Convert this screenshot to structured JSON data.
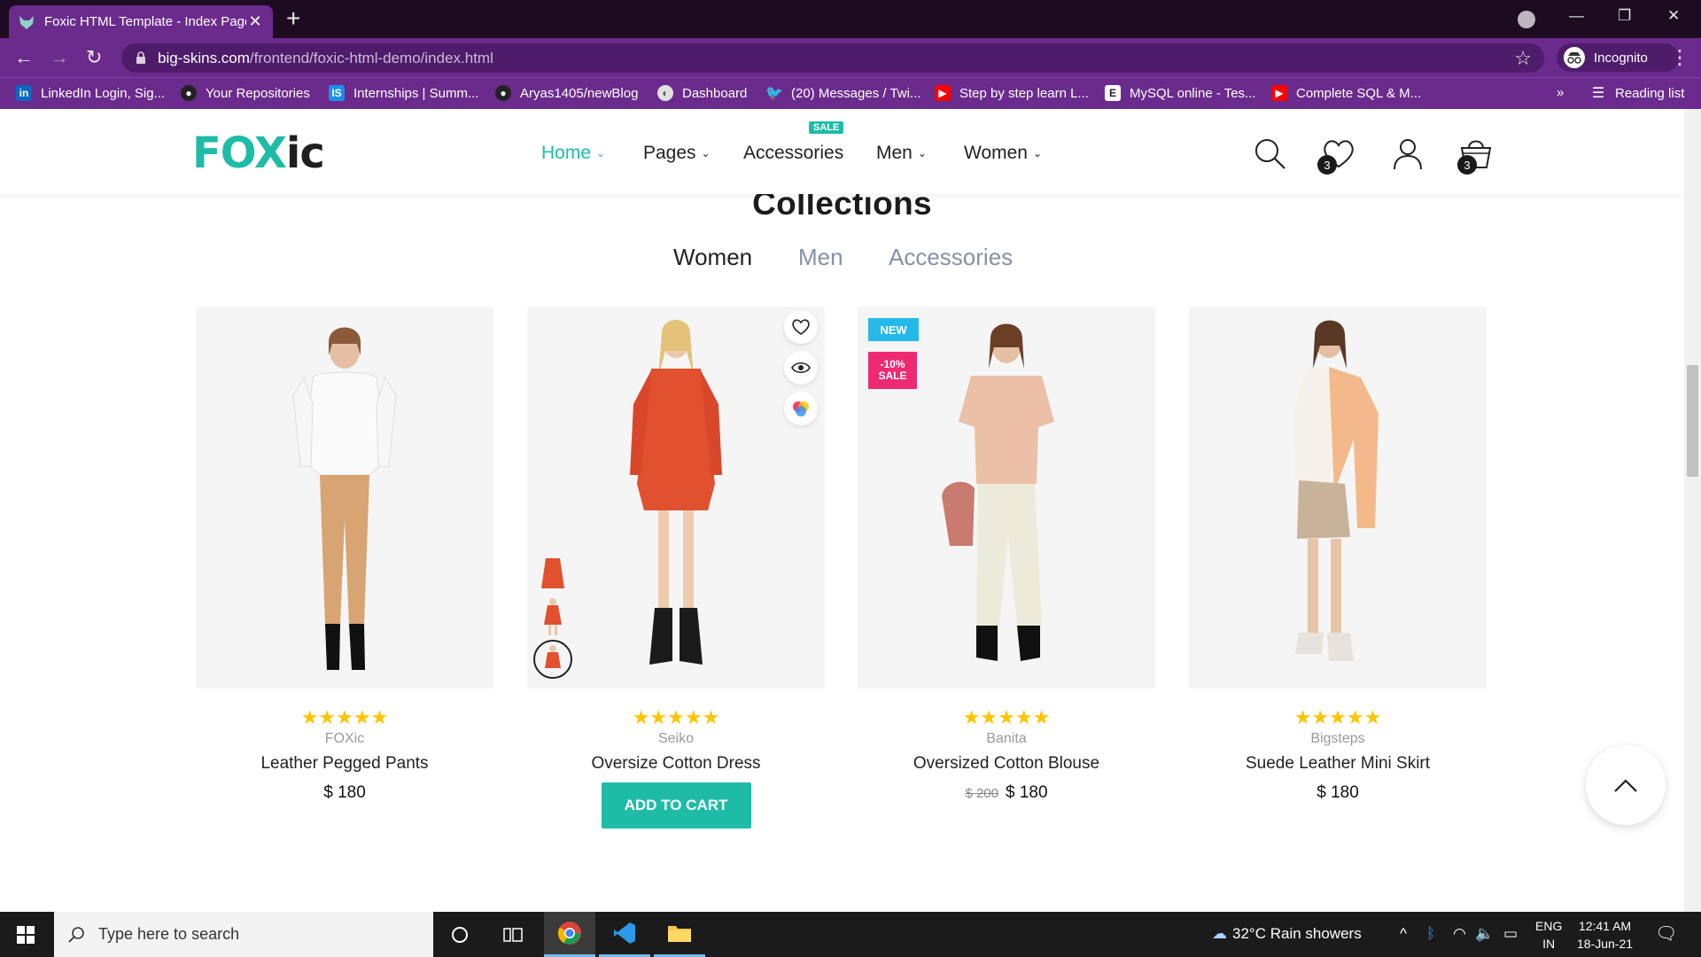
{
  "browser": {
    "tab_title": "Foxic HTML Template - Index Page",
    "url_host": "big-skins.com",
    "url_path": "/frontend/foxic-html-demo/index.html",
    "incognito_label": "Incognito",
    "reading_list_label": "Reading list",
    "bookmarks": [
      {
        "label": "LinkedIn Login, Sig...",
        "icon": "linkedin-icon",
        "color": "#0a66c2"
      },
      {
        "label": "Your Repositories",
        "icon": "github-icon",
        "color": "#222222"
      },
      {
        "label": "Internships | Summ...",
        "icon": "internshala-icon",
        "color": "#1a8ff0"
      },
      {
        "label": "Aryas1405/newBlog",
        "icon": "github-icon",
        "color": "#222222"
      },
      {
        "label": "Dashboard",
        "icon": "chrome-globe-icon",
        "color": "#555555"
      },
      {
        "label": "(20) Messages / Twi...",
        "icon": "twitter-icon",
        "color": "#1d9bf0"
      },
      {
        "label": "Step by step learn L...",
        "icon": "youtube-icon",
        "color": "#ff0000"
      },
      {
        "label": "MySQL online - Tes...",
        "icon": "e-icon",
        "color": "#222222"
      },
      {
        "label": "Complete SQL & M...",
        "icon": "youtube-icon",
        "color": "#ff0000"
      }
    ]
  },
  "site": {
    "logo_part1": "FOX",
    "logo_part2": "ic",
    "nav": [
      {
        "label": "Home",
        "active": true
      },
      {
        "label": "Pages"
      },
      {
        "label": "Accessories",
        "badge": "SALE"
      },
      {
        "label": "Men"
      },
      {
        "label": "Women"
      }
    ],
    "wishlist_count": "3",
    "cart_count": "3",
    "accent_color": "#1ebca7"
  },
  "collections": {
    "title": "Collections",
    "tabs": [
      "Women",
      "Men",
      "Accessories"
    ],
    "products": [
      {
        "brand": "FOXic",
        "name": "Leather Pegged Pants",
        "price": "$ 180",
        "rating": 5
      },
      {
        "brand": "Seiko",
        "name": "Oversize Cotton Dress",
        "price": "",
        "rating": 5,
        "button": "ADD TO CART"
      },
      {
        "brand": "Banita",
        "name": "Oversized Cotton Blouse",
        "price": "$ 180",
        "old_price": "$ 200",
        "rating": 5,
        "badge_new": "NEW",
        "badge_sale_pct": "-10%",
        "badge_sale": "SALE"
      },
      {
        "brand": "Bigsteps",
        "name": "Suede Leather Mini Skirt",
        "price": "$ 180",
        "rating": 5
      }
    ]
  },
  "taskbar": {
    "search_placeholder": "Type here to search",
    "weather": "32°C  Rain showers",
    "lang1": "ENG",
    "lang2": "IN",
    "time": "12:41 AM",
    "date": "18-Jun-21"
  }
}
